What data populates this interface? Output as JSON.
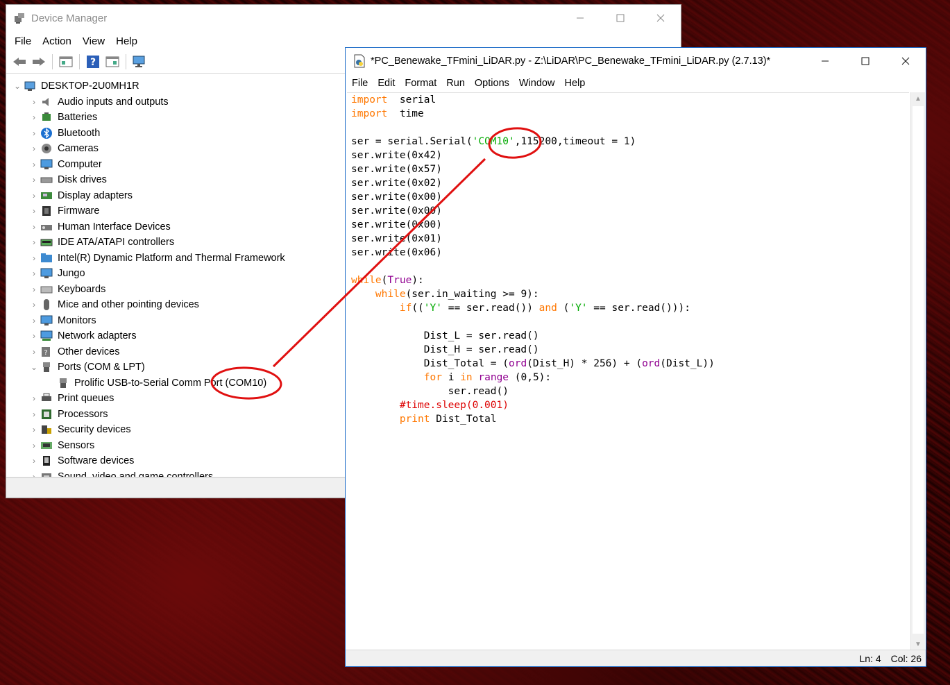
{
  "device_manager": {
    "title": "Device Manager",
    "menu": [
      "File",
      "Action",
      "View",
      "Help"
    ],
    "root": "DESKTOP-2U0MH1R",
    "items": [
      {
        "label": "Audio inputs and outputs",
        "icon": "speaker-icon",
        "expanded": false
      },
      {
        "label": "Batteries",
        "icon": "battery-icon",
        "expanded": false
      },
      {
        "label": "Bluetooth",
        "icon": "bluetooth-icon",
        "expanded": false
      },
      {
        "label": "Cameras",
        "icon": "camera-icon",
        "expanded": false
      },
      {
        "label": "Computer",
        "icon": "monitor-icon",
        "expanded": false
      },
      {
        "label": "Disk drives",
        "icon": "disk-icon",
        "expanded": false
      },
      {
        "label": "Display adapters",
        "icon": "display-adapter-icon",
        "expanded": false
      },
      {
        "label": "Firmware",
        "icon": "chip-icon",
        "expanded": false
      },
      {
        "label": "Human Interface Devices",
        "icon": "hid-icon",
        "expanded": false
      },
      {
        "label": "IDE ATA/ATAPI controllers",
        "icon": "ide-icon",
        "expanded": false
      },
      {
        "label": "Intel(R) Dynamic Platform and Thermal Framework",
        "icon": "folder-icon",
        "expanded": false
      },
      {
        "label": "Jungo",
        "icon": "monitor-icon",
        "expanded": false
      },
      {
        "label": "Keyboards",
        "icon": "keyboard-icon",
        "expanded": false
      },
      {
        "label": "Mice and other pointing devices",
        "icon": "mouse-icon",
        "expanded": false
      },
      {
        "label": "Monitors",
        "icon": "monitor-icon",
        "expanded": false
      },
      {
        "label": "Network adapters",
        "icon": "network-icon",
        "expanded": false
      },
      {
        "label": "Other devices",
        "icon": "unknown-device-icon",
        "expanded": false
      },
      {
        "label": "Ports (COM & LPT)",
        "icon": "port-icon",
        "expanded": true,
        "children": [
          {
            "label": "Prolific USB-to-Serial Comm Port (COM10)",
            "icon": "port-icon"
          }
        ]
      },
      {
        "label": "Print queues",
        "icon": "printer-icon",
        "expanded": false
      },
      {
        "label": "Processors",
        "icon": "processor-icon",
        "expanded": false
      },
      {
        "label": "Security devices",
        "icon": "security-icon",
        "expanded": false
      },
      {
        "label": "Sensors",
        "icon": "sensor-icon",
        "expanded": false
      },
      {
        "label": "Software devices",
        "icon": "software-icon",
        "expanded": false
      },
      {
        "label": "Sound, video and game controllers",
        "icon": "sound-icon",
        "expanded": false
      }
    ]
  },
  "idle": {
    "title": "*PC_Benewake_TFmini_LiDAR.py - Z:\\LiDAR\\PC_Benewake_TFmini_LiDAR.py (2.7.13)*",
    "menu": [
      "File",
      "Edit",
      "Format",
      "Run",
      "Options",
      "Window",
      "Help"
    ],
    "code": [
      [
        [
          "kw",
          "import"
        ],
        [
          "",
          "  serial"
        ]
      ],
      [
        [
          "kw",
          "import"
        ],
        [
          "",
          "  time"
        ]
      ],
      [],
      [
        [
          "",
          "ser = serial.Serial("
        ],
        [
          "str",
          "'COM10'"
        ],
        [
          "",
          ",115200,timeout = 1)"
        ]
      ],
      [
        [
          "",
          "ser.write(0x42)"
        ]
      ],
      [
        [
          "",
          "ser.write(0x57)"
        ]
      ],
      [
        [
          "",
          "ser.write(0x02)"
        ]
      ],
      [
        [
          "",
          "ser.write(0x00)"
        ]
      ],
      [
        [
          "",
          "ser.write(0x00)"
        ]
      ],
      [
        [
          "",
          "ser.write(0x00)"
        ]
      ],
      [
        [
          "",
          "ser.write(0x01)"
        ]
      ],
      [
        [
          "",
          "ser.write(0x06)"
        ]
      ],
      [],
      [
        [
          "kw",
          "while"
        ],
        [
          "",
          "("
        ],
        [
          "bi",
          "True"
        ],
        [
          "",
          "):"
        ]
      ],
      [
        [
          "",
          "    "
        ],
        [
          "kw",
          "while"
        ],
        [
          "",
          "(ser.in_waiting >= 9):"
        ]
      ],
      [
        [
          "",
          "        "
        ],
        [
          "kw",
          "if"
        ],
        [
          "",
          "(("
        ],
        [
          "str",
          "'Y'"
        ],
        [
          "",
          " == ser.read()) "
        ],
        [
          "kw",
          "and"
        ],
        [
          "",
          " ("
        ],
        [
          "str",
          "'Y'"
        ],
        [
          "",
          " == ser.read())):"
        ]
      ],
      [],
      [
        [
          "",
          "            Dist_L = ser.read()"
        ]
      ],
      [
        [
          "",
          "            Dist_H = ser.read()"
        ]
      ],
      [
        [
          "",
          "            Dist_Total = ("
        ],
        [
          "bi",
          "ord"
        ],
        [
          "",
          "(Dist_H) * 256) + ("
        ],
        [
          "bi",
          "ord"
        ],
        [
          "",
          "(Dist_L))"
        ]
      ],
      [
        [
          "",
          "            "
        ],
        [
          "kw",
          "for"
        ],
        [
          "",
          " i "
        ],
        [
          "kw",
          "in"
        ],
        [
          "",
          " "
        ],
        [
          "bi",
          "range"
        ],
        [
          "",
          " (0,5):"
        ]
      ],
      [
        [
          "",
          "                ser.read()"
        ]
      ],
      [
        [
          "",
          "        "
        ],
        [
          "cm",
          "#time.sleep(0.001)"
        ]
      ],
      [
        [
          "",
          "        "
        ],
        [
          "kw",
          "print"
        ],
        [
          "",
          " Dist_Total"
        ]
      ]
    ],
    "status": {
      "ln": "Ln: 4",
      "col": "Col: 26"
    }
  },
  "colors": {
    "annotation": "#e01010"
  }
}
